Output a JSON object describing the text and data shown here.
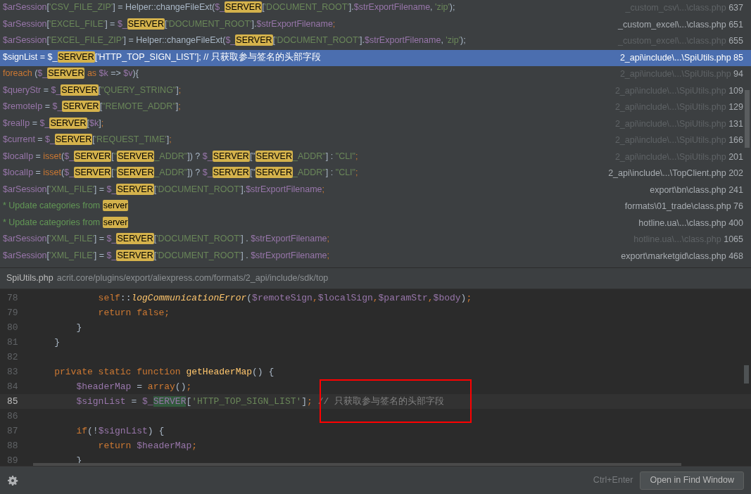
{
  "results": [
    {
      "selected": false,
      "code": [
        {
          "kind": "var",
          "text": "$arSession"
        },
        {
          "kind": "plain",
          "text": "["
        },
        {
          "kind": "str",
          "text": "'CSV_FILE_ZIP'"
        },
        {
          "kind": "plain",
          "text": "] = Helper::changeFileExt("
        },
        {
          "kind": "var",
          "text": "$_"
        },
        {
          "kind": "match",
          "text": "SERVER"
        },
        {
          "kind": "plain",
          "text": "["
        },
        {
          "kind": "str",
          "text": "'DOCUMENT_ROOT'"
        },
        {
          "kind": "plain",
          "text": "]."
        },
        {
          "kind": "var",
          "text": "$strExportFilename"
        },
        {
          "kind": "plain",
          "text": ", "
        },
        {
          "kind": "str",
          "text": "'zip'"
        },
        {
          "kind": "plain",
          "text": ");"
        }
      ],
      "location": {
        "path": "_custom_csv\\...\\class.php",
        "line": "637",
        "dimmed": true
      }
    },
    {
      "selected": false,
      "code": [
        {
          "kind": "var",
          "text": "$arSession"
        },
        {
          "kind": "plain",
          "text": "["
        },
        {
          "kind": "str",
          "text": "'EXCEL_FILE'"
        },
        {
          "kind": "plain",
          "text": "] = "
        },
        {
          "kind": "var",
          "text": "$_"
        },
        {
          "kind": "match",
          "text": "SERVER"
        },
        {
          "kind": "plain",
          "text": "["
        },
        {
          "kind": "str",
          "text": "'DOCUMENT_ROOT'"
        },
        {
          "kind": "plain",
          "text": "]."
        },
        {
          "kind": "var",
          "text": "$strExportFilename"
        },
        {
          "kind": "kw",
          "text": ";"
        }
      ],
      "location": {
        "path": "_custom_excel\\...\\class.php",
        "line": "651",
        "dimmed": false
      }
    },
    {
      "selected": false,
      "code": [
        {
          "kind": "var",
          "text": "$arSession"
        },
        {
          "kind": "plain",
          "text": "["
        },
        {
          "kind": "str",
          "text": "'EXCEL_FILE_ZIP'"
        },
        {
          "kind": "plain",
          "text": "] = Helper::changeFileExt("
        },
        {
          "kind": "var",
          "text": "$_"
        },
        {
          "kind": "match",
          "text": "SERVER"
        },
        {
          "kind": "plain",
          "text": "["
        },
        {
          "kind": "str",
          "text": "'DOCUMENT_ROOT'"
        },
        {
          "kind": "plain",
          "text": "]."
        },
        {
          "kind": "var",
          "text": "$strExportFilename"
        },
        {
          "kind": "plain",
          "text": ", "
        },
        {
          "kind": "str",
          "text": "'zip'"
        },
        {
          "kind": "plain",
          "text": ");"
        }
      ],
      "location": {
        "path": "_custom_excel\\...\\class.php",
        "line": "655",
        "dimmed": true
      }
    },
    {
      "selected": true,
      "code": [
        {
          "kind": "var",
          "text": "$signList"
        },
        {
          "kind": "plain",
          "text": " = "
        },
        {
          "kind": "var",
          "text": "$_"
        },
        {
          "kind": "match",
          "text": "SERVER"
        },
        {
          "kind": "plain",
          "text": "["
        },
        {
          "kind": "str",
          "text": "'HTTP_TOP_SIGN_LIST'"
        },
        {
          "kind": "plain",
          "text": "]; "
        },
        {
          "kind": "comment",
          "text": "// 只获取参与签名的头部字段"
        }
      ],
      "location": {
        "path": "2_api\\include\\...\\SpiUtils.php",
        "line": "85",
        "dimmed": false
      }
    },
    {
      "selected": false,
      "code": [
        {
          "kind": "kw",
          "text": "foreach"
        },
        {
          "kind": "plain",
          "text": " ("
        },
        {
          "kind": "var",
          "text": "$_"
        },
        {
          "kind": "match",
          "text": "SERVER"
        },
        {
          "kind": "kw",
          "text": " as "
        },
        {
          "kind": "var",
          "text": "$k"
        },
        {
          "kind": "plain",
          "text": " => "
        },
        {
          "kind": "var",
          "text": "$v"
        },
        {
          "kind": "plain",
          "text": "){"
        }
      ],
      "location": {
        "path": "2_api\\include\\...\\SpiUtils.php",
        "line": "94",
        "dimmed": true
      }
    },
    {
      "selected": false,
      "code": [
        {
          "kind": "var",
          "text": "$queryStr"
        },
        {
          "kind": "plain",
          "text": " = "
        },
        {
          "kind": "var",
          "text": "$_"
        },
        {
          "kind": "match",
          "text": "SERVER"
        },
        {
          "kind": "plain",
          "text": "["
        },
        {
          "kind": "str",
          "text": "\"QUERY_STRING\""
        },
        {
          "kind": "plain",
          "text": "]"
        },
        {
          "kind": "kw",
          "text": ";"
        }
      ],
      "location": {
        "path": "2_api\\include\\...\\SpiUtils.php",
        "line": "109",
        "dimmed": true
      }
    },
    {
      "selected": false,
      "code": [
        {
          "kind": "var",
          "text": "$remoteIp"
        },
        {
          "kind": "plain",
          "text": " = "
        },
        {
          "kind": "var",
          "text": "$_"
        },
        {
          "kind": "match",
          "text": "SERVER"
        },
        {
          "kind": "plain",
          "text": "["
        },
        {
          "kind": "str",
          "text": "\"REMOTE_ADDR\""
        },
        {
          "kind": "plain",
          "text": "]"
        },
        {
          "kind": "kw",
          "text": ";"
        }
      ],
      "location": {
        "path": "2_api\\include\\...\\SpiUtils.php",
        "line": "129",
        "dimmed": true
      }
    },
    {
      "selected": false,
      "code": [
        {
          "kind": "var",
          "text": "$realIp"
        },
        {
          "kind": "plain",
          "text": " = "
        },
        {
          "kind": "var",
          "text": "$_"
        },
        {
          "kind": "match",
          "text": "SERVER"
        },
        {
          "kind": "plain",
          "text": "["
        },
        {
          "kind": "var",
          "text": "$k"
        },
        {
          "kind": "plain",
          "text": "]"
        },
        {
          "kind": "kw",
          "text": ";"
        }
      ],
      "location": {
        "path": "2_api\\include\\...\\SpiUtils.php",
        "line": "131",
        "dimmed": true
      }
    },
    {
      "selected": false,
      "code": [
        {
          "kind": "var",
          "text": "$current"
        },
        {
          "kind": "plain",
          "text": " = "
        },
        {
          "kind": "var",
          "text": "$_"
        },
        {
          "kind": "match",
          "text": "SERVER"
        },
        {
          "kind": "plain",
          "text": "["
        },
        {
          "kind": "str",
          "text": "'REQUEST_TIME'"
        },
        {
          "kind": "plain",
          "text": "]"
        },
        {
          "kind": "kw",
          "text": ";"
        }
      ],
      "location": {
        "path": "2_api\\include\\...\\SpiUtils.php",
        "line": "166",
        "dimmed": true
      }
    },
    {
      "selected": false,
      "code": [
        {
          "kind": "var",
          "text": "$localIp"
        },
        {
          "kind": "plain",
          "text": " = "
        },
        {
          "kind": "kw",
          "text": "isset"
        },
        {
          "kind": "plain",
          "text": "("
        },
        {
          "kind": "var",
          "text": "$_"
        },
        {
          "kind": "match",
          "text": "SERVER"
        },
        {
          "kind": "plain",
          "text": "["
        },
        {
          "kind": "str",
          "text": "\""
        },
        {
          "kind": "match",
          "text": "SERVER"
        },
        {
          "kind": "str",
          "text": "_ADDR\""
        },
        {
          "kind": "plain",
          "text": "]) ? "
        },
        {
          "kind": "var",
          "text": "$_"
        },
        {
          "kind": "match",
          "text": "SERVER"
        },
        {
          "kind": "plain",
          "text": "[\""
        },
        {
          "kind": "match",
          "text": "SERVER"
        },
        {
          "kind": "str",
          "text": "_ADDR\""
        },
        {
          "kind": "plain",
          "text": "] : "
        },
        {
          "kind": "str",
          "text": "\"CLI\""
        },
        {
          "kind": "kw",
          "text": ";"
        }
      ],
      "location": {
        "path": "2_api\\include\\...\\SpiUtils.php",
        "line": "201",
        "dimmed": true
      }
    },
    {
      "selected": false,
      "code": [
        {
          "kind": "var",
          "text": "$localIp"
        },
        {
          "kind": "plain",
          "text": " = "
        },
        {
          "kind": "kw",
          "text": "isset"
        },
        {
          "kind": "plain",
          "text": "("
        },
        {
          "kind": "var",
          "text": "$_"
        },
        {
          "kind": "match",
          "text": "SERVER"
        },
        {
          "kind": "plain",
          "text": "["
        },
        {
          "kind": "str",
          "text": "\""
        },
        {
          "kind": "match",
          "text": "SERVER"
        },
        {
          "kind": "str",
          "text": "_ADDR\""
        },
        {
          "kind": "plain",
          "text": "]) ? "
        },
        {
          "kind": "var",
          "text": "$_"
        },
        {
          "kind": "match",
          "text": "SERVER"
        },
        {
          "kind": "plain",
          "text": "[\""
        },
        {
          "kind": "match",
          "text": "SERVER"
        },
        {
          "kind": "str",
          "text": "_ADDR\""
        },
        {
          "kind": "plain",
          "text": "] : "
        },
        {
          "kind": "str",
          "text": "\"CLI\""
        },
        {
          "kind": "kw",
          "text": ";"
        }
      ],
      "location": {
        "path": "2_api\\include\\...\\TopClient.php",
        "line": "202",
        "dimmed": false
      }
    },
    {
      "selected": false,
      "code": [
        {
          "kind": "var",
          "text": "$arSession"
        },
        {
          "kind": "plain",
          "text": "["
        },
        {
          "kind": "str",
          "text": "'XML_FILE'"
        },
        {
          "kind": "plain",
          "text": "] = "
        },
        {
          "kind": "var",
          "text": "$_"
        },
        {
          "kind": "match",
          "text": "SERVER"
        },
        {
          "kind": "plain",
          "text": "["
        },
        {
          "kind": "str",
          "text": "'DOCUMENT_ROOT'"
        },
        {
          "kind": "plain",
          "text": "]."
        },
        {
          "kind": "var",
          "text": "$strExportFilename"
        },
        {
          "kind": "kw",
          "text": ";"
        }
      ],
      "location": {
        "path": "export\\bn\\class.php",
        "line": "241",
        "dimmed": false
      }
    },
    {
      "selected": false,
      "code": [
        {
          "kind": "doc",
          "text": "* Update categories from "
        },
        {
          "kind": "match",
          "text": "server"
        }
      ],
      "location": {
        "path": "formats\\01_trade\\class.php",
        "line": "76",
        "dimmed": false
      }
    },
    {
      "selected": false,
      "code": [
        {
          "kind": "doc",
          "text": "* Update categories from "
        },
        {
          "kind": "match",
          "text": "server"
        }
      ],
      "location": {
        "path": "hotline.ua\\...\\class.php",
        "line": "400",
        "dimmed": false
      }
    },
    {
      "selected": false,
      "code": [
        {
          "kind": "var",
          "text": "$arSession"
        },
        {
          "kind": "plain",
          "text": "["
        },
        {
          "kind": "str",
          "text": "'XML_FILE'"
        },
        {
          "kind": "plain",
          "text": "] = "
        },
        {
          "kind": "var",
          "text": "$_"
        },
        {
          "kind": "match",
          "text": "SERVER"
        },
        {
          "kind": "plain",
          "text": "["
        },
        {
          "kind": "str",
          "text": "'DOCUMENT_ROOT'"
        },
        {
          "kind": "plain",
          "text": "] . "
        },
        {
          "kind": "var",
          "text": "$strExportFilename"
        },
        {
          "kind": "kw",
          "text": ";"
        }
      ],
      "location": {
        "path": "hotline.ua\\...\\class.php",
        "line": "1065",
        "dimmed": true
      }
    },
    {
      "selected": false,
      "code": [
        {
          "kind": "var",
          "text": "$arSession"
        },
        {
          "kind": "plain",
          "text": "["
        },
        {
          "kind": "str",
          "text": "'XML_FILE'"
        },
        {
          "kind": "plain",
          "text": "] = "
        },
        {
          "kind": "var",
          "text": "$_"
        },
        {
          "kind": "match",
          "text": "SERVER"
        },
        {
          "kind": "plain",
          "text": "["
        },
        {
          "kind": "str",
          "text": "'DOCUMENT_ROOT'"
        },
        {
          "kind": "plain",
          "text": "] . "
        },
        {
          "kind": "var",
          "text": "$strExportFilename"
        },
        {
          "kind": "kw",
          "text": ";"
        }
      ],
      "location": {
        "path": "export\\marketgid\\class.php",
        "line": "468",
        "dimmed": false
      }
    }
  ],
  "preview": {
    "file": "SpiUtils.php",
    "path": "acrit.core/plugins/export/aliexpress.com/formats/2_api/include/sdk/top",
    "lines": [
      {
        "number": "78",
        "current": false,
        "code": [
          {
            "kind": "kw",
            "text": "            self"
          },
          {
            "kind": "plain",
            "text": "::"
          },
          {
            "kind": "call",
            "text": "logCommunicationError"
          },
          {
            "kind": "plain",
            "text": "("
          },
          {
            "kind": "var",
            "text": "$remoteSign"
          },
          {
            "kind": "kw",
            "text": ","
          },
          {
            "kind": "var",
            "text": "$localSign"
          },
          {
            "kind": "kw",
            "text": ","
          },
          {
            "kind": "var",
            "text": "$paramStr"
          },
          {
            "kind": "kw",
            "text": ","
          },
          {
            "kind": "var",
            "text": "$body"
          },
          {
            "kind": "plain",
            "text": ")"
          },
          {
            "kind": "kw",
            "text": ";"
          }
        ]
      },
      {
        "number": "79",
        "current": false,
        "code": [
          {
            "kind": "kw",
            "text": "            return false;"
          }
        ]
      },
      {
        "number": "80",
        "current": false,
        "code": [
          {
            "kind": "plain",
            "text": "        }"
          }
        ]
      },
      {
        "number": "81",
        "current": false,
        "code": [
          {
            "kind": "plain",
            "text": "    }"
          }
        ]
      },
      {
        "number": "82",
        "current": false
      },
      {
        "number": "83",
        "current": false,
        "code": [
          {
            "kind": "kw",
            "text": "    private static function "
          },
          {
            "kind": "decl",
            "text": "getHeaderMap"
          },
          {
            "kind": "plain",
            "text": "() {"
          }
        ]
      },
      {
        "number": "84",
        "current": false,
        "code": [
          {
            "kind": "var",
            "text": "        $headerMap"
          },
          {
            "kind": "plain",
            "text": " = "
          },
          {
            "kind": "kw",
            "text": "array"
          },
          {
            "kind": "plain",
            "text": "()"
          },
          {
            "kind": "kw",
            "text": ";"
          }
        ]
      },
      {
        "number": "85",
        "current": true,
        "code": [
          {
            "kind": "var",
            "text": "        $signList"
          },
          {
            "kind": "plain",
            "text": " = "
          },
          {
            "kind": "var",
            "text": "$_"
          },
          {
            "kind": "server",
            "text": "SERVER"
          },
          {
            "kind": "plain",
            "text": "["
          },
          {
            "kind": "str",
            "text": "'HTTP_TOP_SIGN_LIST'"
          },
          {
            "kind": "plain",
            "text": "]"
          },
          {
            "kind": "kw",
            "text": ";"
          },
          {
            "kind": "comment",
            "text": " // 只获取参与签名的头部字段"
          }
        ]
      },
      {
        "number": "86",
        "current": false
      },
      {
        "number": "87",
        "current": false,
        "code": [
          {
            "kind": "kw",
            "text": "        if"
          },
          {
            "kind": "plain",
            "text": "(!"
          },
          {
            "kind": "var",
            "text": "$signList"
          },
          {
            "kind": "plain",
            "text": ") {"
          }
        ]
      },
      {
        "number": "88",
        "current": false,
        "code": [
          {
            "kind": "kw",
            "text": "            return "
          },
          {
            "kind": "var",
            "text": "$headerMap"
          },
          {
            "kind": "kw",
            "text": ";"
          }
        ]
      },
      {
        "number": "89",
        "current": false,
        "code": [
          {
            "kind": "plain",
            "text": "        }"
          }
        ]
      }
    ]
  },
  "footer": {
    "shortcut": "Ctrl+Enter",
    "button": "Open in Find Window"
  }
}
